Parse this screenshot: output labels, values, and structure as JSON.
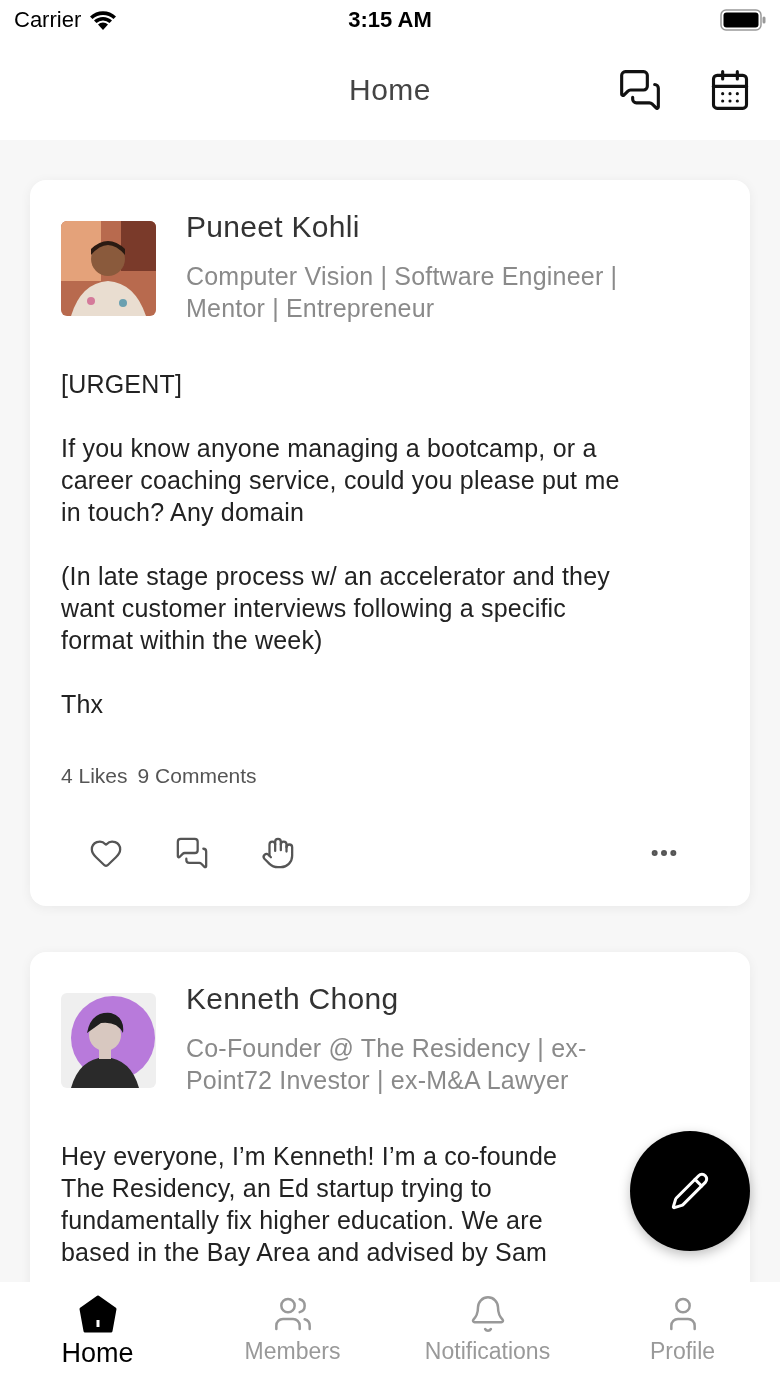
{
  "status_bar": {
    "carrier": "Carrier",
    "time": "3:15 AM"
  },
  "header": {
    "title": "Home"
  },
  "posts": [
    {
      "author": "Puneet Kohli",
      "avatar": {
        "kind": "picture"
      },
      "headline": [
        "Computer Vision | Software Engineer |",
        "Mentor | Entrepreneur"
      ],
      "paragraphs": [
        [
          "[URGENT]"
        ],
        [
          "If you know anyone managing a bootcamp, or a",
          "career coaching service, could you please put me",
          "in touch? Any domain"
        ],
        [
          "(In late stage process w/ an accelerator and they",
          "want customer interviews following a specific",
          "format within the week)"
        ],
        [
          "Thx"
        ]
      ],
      "stats": {
        "likes": "4 Likes",
        "comments": "9 Comments"
      }
    },
    {
      "author": "Kenneth Chong",
      "avatar": {
        "kind": "picture"
      },
      "headline": [
        "Co-Founder @ The Residency | ex-",
        "Point72 Investor | ex-M&A Lawyer"
      ],
      "paragraphs": [
        [
          "Hey everyone, I’m Kenneth! I’m a co-founde",
          "The Residency, an Ed startup trying to",
          "fundamentally fix higher education. We are",
          "based in the Bay Area and advised by Sam"
        ]
      ]
    }
  ],
  "tabs": [
    {
      "label": "Home",
      "selected": true
    },
    {
      "label": "Members",
      "selected": false
    },
    {
      "label": "Notifications",
      "selected": false
    },
    {
      "label": "Profile",
      "selected": false
    }
  ]
}
